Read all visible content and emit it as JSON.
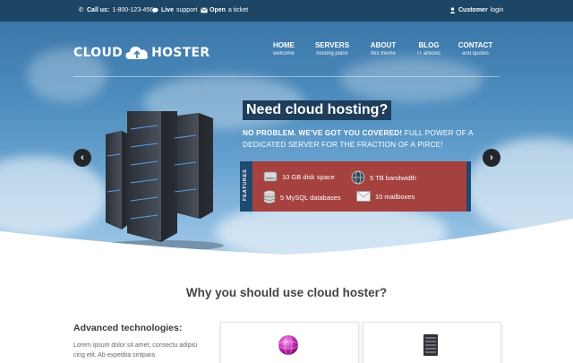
{
  "topbar": {
    "call_label": "Call us:",
    "phone": "1-800-123-456",
    "live_label": "Live",
    "live_rest": "support",
    "ticket_label": "Open",
    "ticket_rest": "a ticket",
    "customer_label": "Customer",
    "customer_rest": "login"
  },
  "logo": {
    "left": "CLOUD",
    "right": "HOSTER"
  },
  "nav": [
    {
      "title": "HOME",
      "sub": "welcome"
    },
    {
      "title": "SERVERS",
      "sub": "hosting plans"
    },
    {
      "title": "ABOUT",
      "sub": "this theme"
    },
    {
      "title": "BLOG",
      "sub": "IT articles"
    },
    {
      "title": "CONTACT",
      "sub": "and quotes"
    }
  ],
  "hero": {
    "headline": "Need cloud hosting?",
    "sub_bold": "NO PROBLEM. WE'VE GOT YOU COVERED!",
    "sub_rest": " FULL POWER OF A DEDICATED SERVER FOR THE FRACTION OF A PIRCE!",
    "features_label": "FEATURES",
    "features": [
      {
        "icon": "hard-drive-icon",
        "text": "10 GB disk space"
      },
      {
        "icon": "globe-icon",
        "text": "5 TB bandwidth"
      },
      {
        "icon": "database-icon",
        "text": "5 MySQL databases"
      },
      {
        "icon": "envelope-icon",
        "text": "10 mailboxes"
      }
    ],
    "prev_arrow": "‹",
    "next_arrow": "›"
  },
  "section": {
    "title": "Why you should use cloud hoster?",
    "adv_title": "Advanced technologies:",
    "adv_text": "Lorem ipsum dolor sit amet, consectu adipisi cing elit. Ab expedita sintpara"
  },
  "colors": {
    "topbar": "#1d4566",
    "feature_box": "#a5413f",
    "feature_label": "#1f4a70",
    "headline_bg": "#1e3d5b"
  }
}
